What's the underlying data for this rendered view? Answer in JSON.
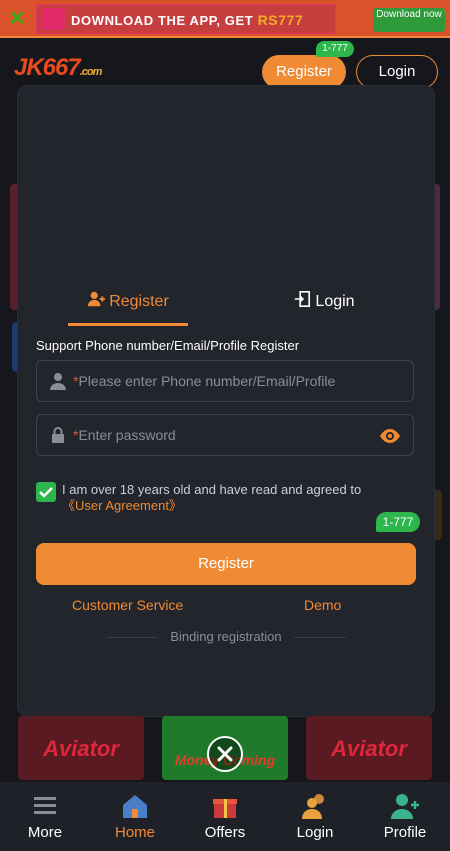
{
  "topbar": {
    "banner_text": "DOWNLOAD THE APP, GET",
    "banner_amount": "RS777",
    "download_label": "Download now"
  },
  "header": {
    "brand": "JK667",
    "brand_suffix": ".com",
    "register_label": "Register",
    "register_badge": "1-777",
    "login_label": "Login"
  },
  "modal": {
    "tabs": [
      {
        "label": "Register"
      },
      {
        "label": "Login"
      }
    ],
    "form_label": "Support Phone number/Email/Profile Register",
    "identifier_placeholder": "Please enter Phone number/Email/Profile",
    "password_placeholder": "Enter password",
    "required_mark": "*",
    "agree_text": "I am over 18 years old and have read and agreed to",
    "agree_link": "《User Agreement》",
    "register_badge": "1-777",
    "register_button": "Register",
    "customer_service": "Customer Service",
    "demo": "Demo",
    "binding": "Binding registration"
  },
  "games": [
    {
      "name": "Aviator"
    },
    {
      "name": "Money Coming"
    },
    {
      "name": "Aviator"
    }
  ],
  "bottom_nav": [
    {
      "label": "More"
    },
    {
      "label": "Home"
    },
    {
      "label": "Offers"
    },
    {
      "label": "Login"
    },
    {
      "label": "Profile"
    }
  ],
  "colors": {
    "accent": "#f08a34",
    "success": "#2db64b",
    "background": "#15171c",
    "modal": "#22252c"
  }
}
